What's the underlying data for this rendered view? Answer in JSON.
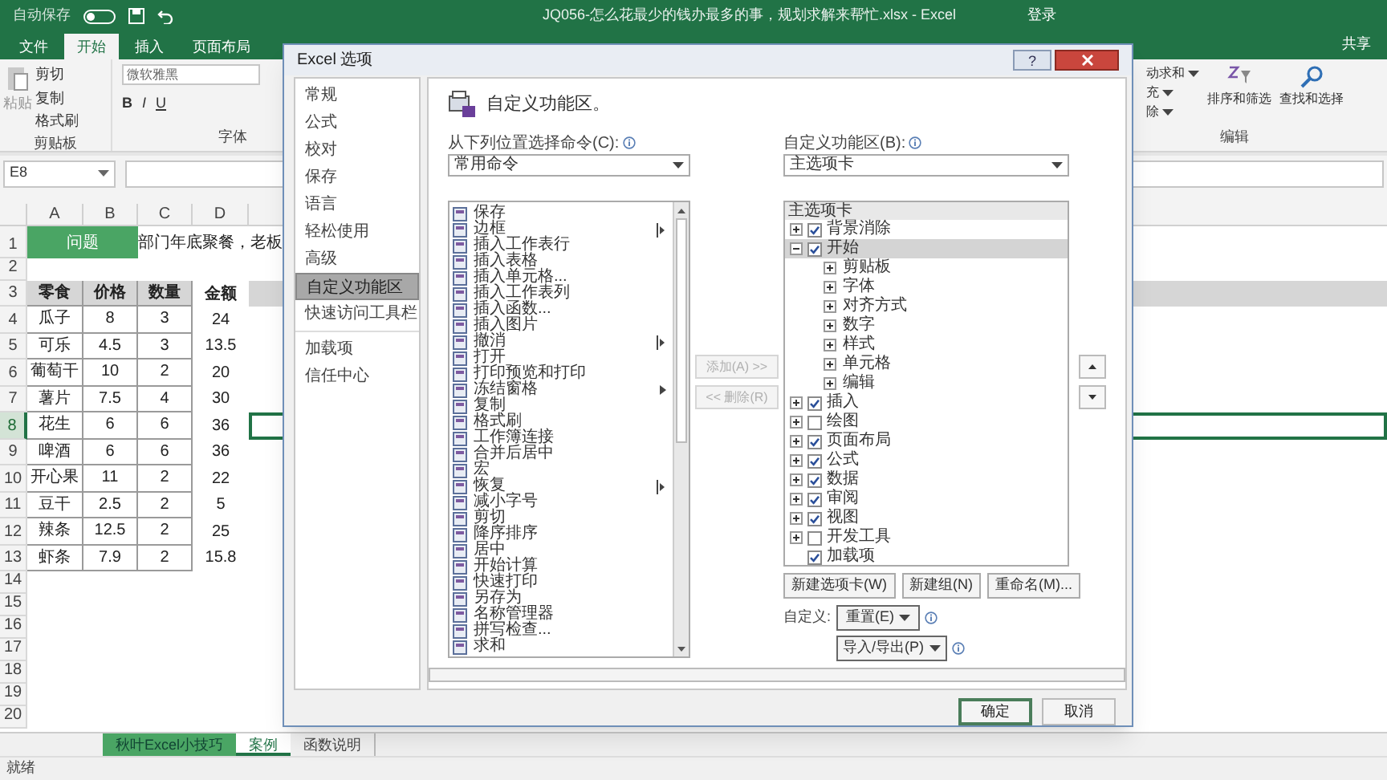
{
  "excel": {
    "title": "JQ056-怎么花最少的钱办最多的事，规划求解来帮忙.xlsx - Excel",
    "autosave_label": "自动保存",
    "autosave_on": false,
    "login": "登录",
    "share": "共享",
    "ribbon_tabs": [
      {
        "label": "文件",
        "selected": false
      },
      {
        "label": "开始",
        "selected": true
      },
      {
        "label": "插入",
        "selected": false
      },
      {
        "label": "页面布局",
        "selected": false
      }
    ],
    "clipboard": {
      "paste": "粘贴",
      "cut": "剪切",
      "copy": "复制",
      "format_painter": "格式刷",
      "group": "剪贴板"
    },
    "font": {
      "name": "微软雅黑",
      "bold": "B",
      "italic": "I",
      "underline": "U",
      "group": "字体"
    },
    "editing": {
      "items": [
        "动求和",
        "充",
        "除"
      ],
      "sort": "排序和筛选",
      "find": "查找和选择",
      "group": "编辑"
    },
    "name_box": "E8",
    "columns": [
      "A",
      "B",
      "C",
      "D"
    ],
    "rows": [
      {
        "number": "1",
        "kind": "title",
        "selected": false,
        "cells": [
          "问题",
          "部门年底聚餐，老板"
        ]
      },
      {
        "number": "2",
        "kind": "empty",
        "selected": false
      },
      {
        "number": "3",
        "kind": "header",
        "selected": false,
        "cells": [
          "零食",
          "价格",
          "数量",
          "金额"
        ]
      },
      {
        "number": "4",
        "kind": "data",
        "selected": false,
        "cells": [
          "瓜子",
          "8",
          "3",
          "24"
        ]
      },
      {
        "number": "5",
        "kind": "data",
        "selected": false,
        "cells": [
          "可乐",
          "4.5",
          "3",
          "13.5"
        ]
      },
      {
        "number": "6",
        "kind": "data",
        "selected": false,
        "cells": [
          "葡萄干",
          "10",
          "2",
          "20"
        ]
      },
      {
        "number": "7",
        "kind": "data",
        "selected": false,
        "cells": [
          "薯片",
          "7.5",
          "4",
          "30"
        ]
      },
      {
        "number": "8",
        "kind": "data",
        "selected": true,
        "cells": [
          "花生",
          "6",
          "6",
          "36"
        ]
      },
      {
        "number": "9",
        "kind": "data",
        "selected": false,
        "cells": [
          "啤酒",
          "6",
          "6",
          "36"
        ]
      },
      {
        "number": "10",
        "kind": "data",
        "selected": false,
        "cells": [
          "开心果",
          "11",
          "2",
          "22"
        ]
      },
      {
        "number": "11",
        "kind": "data",
        "selected": false,
        "cells": [
          "豆干",
          "2.5",
          "2",
          "5"
        ]
      },
      {
        "number": "12",
        "kind": "data",
        "selected": false,
        "cells": [
          "辣条",
          "12.5",
          "2",
          "25"
        ]
      },
      {
        "number": "13",
        "kind": "data",
        "selected": false,
        "cells": [
          "虾条",
          "7.9",
          "2",
          "15.8"
        ]
      },
      {
        "number": "14",
        "kind": "empty",
        "selected": false
      },
      {
        "number": "15",
        "kind": "empty",
        "selected": false
      },
      {
        "number": "16",
        "kind": "empty",
        "selected": false
      },
      {
        "number": "17",
        "kind": "empty",
        "selected": false
      },
      {
        "number": "18",
        "kind": "empty",
        "selected": false
      },
      {
        "number": "19",
        "kind": "empty",
        "selected": false
      },
      {
        "number": "20",
        "kind": "empty",
        "selected": false
      }
    ],
    "sheet_tabs": [
      {
        "label": "秋叶Excel小技巧",
        "selected": false,
        "color": "#4aa564"
      },
      {
        "label": "案例",
        "selected": true
      },
      {
        "label": "函数说明",
        "selected": false
      }
    ],
    "status": "就绪"
  },
  "dialog": {
    "title": "Excel 选项",
    "help": "?",
    "nav_groups": [
      [
        {
          "label": "常规",
          "selected": false
        },
        {
          "label": "公式",
          "selected": false
        },
        {
          "label": "校对",
          "selected": false
        },
        {
          "label": "保存",
          "selected": false
        },
        {
          "label": "语言",
          "selected": false
        },
        {
          "label": "轻松使用",
          "selected": false
        },
        {
          "label": "高级",
          "selected": false
        },
        {
          "label": "自定义功能区",
          "selected": true
        },
        {
          "label": "快速访问工具栏",
          "selected": false
        }
      ],
      [
        {
          "label": "加载项",
          "selected": false
        },
        {
          "label": "信任中心",
          "selected": false
        }
      ]
    ],
    "heading": "自定义功能区。",
    "commands_label": "从下列位置选择命令(C):",
    "commands_source": "常用命令",
    "commands": [
      {
        "label": "保存",
        "kind": "plain"
      },
      {
        "label": "边框",
        "kind": "split"
      },
      {
        "label": "插入工作表行",
        "kind": "plain"
      },
      {
        "label": "插入表格",
        "kind": "plain"
      },
      {
        "label": "插入单元格...",
        "kind": "plain"
      },
      {
        "label": "插入工作表列",
        "kind": "plain"
      },
      {
        "label": "插入函数...",
        "kind": "plain"
      },
      {
        "label": "插入图片",
        "kind": "plain"
      },
      {
        "label": "撤消",
        "kind": "split"
      },
      {
        "label": "打开",
        "kind": "plain"
      },
      {
        "label": "打印预览和打印",
        "kind": "plain"
      },
      {
        "label": "冻结窗格",
        "kind": "menu"
      },
      {
        "label": "复制",
        "kind": "plain"
      },
      {
        "label": "格式刷",
        "kind": "plain"
      },
      {
        "label": "工作簿连接",
        "kind": "plain"
      },
      {
        "label": "合并后居中",
        "kind": "plain"
      },
      {
        "label": "宏",
        "kind": "plain"
      },
      {
        "label": "恢复",
        "kind": "split"
      },
      {
        "label": "减小字号",
        "kind": "plain"
      },
      {
        "label": "剪切",
        "kind": "plain"
      },
      {
        "label": "降序排序",
        "kind": "plain"
      },
      {
        "label": "居中",
        "kind": "plain"
      },
      {
        "label": "开始计算",
        "kind": "plain"
      },
      {
        "label": "快速打印",
        "kind": "plain"
      },
      {
        "label": "另存为",
        "kind": "plain"
      },
      {
        "label": "名称管理器",
        "kind": "plain"
      },
      {
        "label": "拼写检查...",
        "kind": "plain"
      },
      {
        "label": "求和",
        "kind": "plain"
      }
    ],
    "add": "添加(A) >>",
    "remove": "<< 删除(R)",
    "move_disabled": true,
    "ribbon_label": "自定义功能区(B):",
    "ribbon_source": "主选项卡",
    "tree_header": "主选项卡",
    "tree": [
      {
        "label": "背景消除",
        "kind": "tab",
        "checked": true,
        "expanded": false,
        "selected": false
      },
      {
        "label": "开始",
        "kind": "tab",
        "checked": true,
        "expanded": true,
        "selected": true,
        "children": [
          {
            "label": "剪贴板",
            "expanded": false
          },
          {
            "label": "字体",
            "expanded": false
          },
          {
            "label": "对齐方式",
            "expanded": false
          },
          {
            "label": "数字",
            "expanded": false
          },
          {
            "label": "样式",
            "expanded": false
          },
          {
            "label": "单元格",
            "expanded": false
          },
          {
            "label": "编辑",
            "expanded": false
          }
        ]
      },
      {
        "label": "插入",
        "kind": "tab",
        "checked": true,
        "expanded": false,
        "selected": false
      },
      {
        "label": "绘图",
        "kind": "tab",
        "checked": false,
        "expanded": false,
        "selected": false
      },
      {
        "label": "页面布局",
        "kind": "tab",
        "checked": true,
        "expanded": false,
        "selected": false
      },
      {
        "label": "公式",
        "kind": "tab",
        "checked": true,
        "expanded": false,
        "selected": false
      },
      {
        "label": "数据",
        "kind": "tab",
        "checked": true,
        "expanded": false,
        "selected": false
      },
      {
        "label": "审阅",
        "kind": "tab",
        "checked": true,
        "expanded": false,
        "selected": false
      },
      {
        "label": "视图",
        "kind": "tab",
        "checked": true,
        "expanded": false,
        "selected": false
      },
      {
        "label": "开发工具",
        "kind": "tab",
        "checked": false,
        "expanded": false,
        "selected": false
      },
      {
        "label": "加载项",
        "kind": "leaf",
        "checked": true,
        "selected": false
      }
    ],
    "new_tab": "新建选项卡(W)",
    "new_group": "新建组(N)",
    "rename": "重命名(M)...",
    "customize_label": "自定义:",
    "reset": "重置(E)",
    "import_export": "导入/导出(P)",
    "ok": "确定",
    "cancel": "取消"
  }
}
